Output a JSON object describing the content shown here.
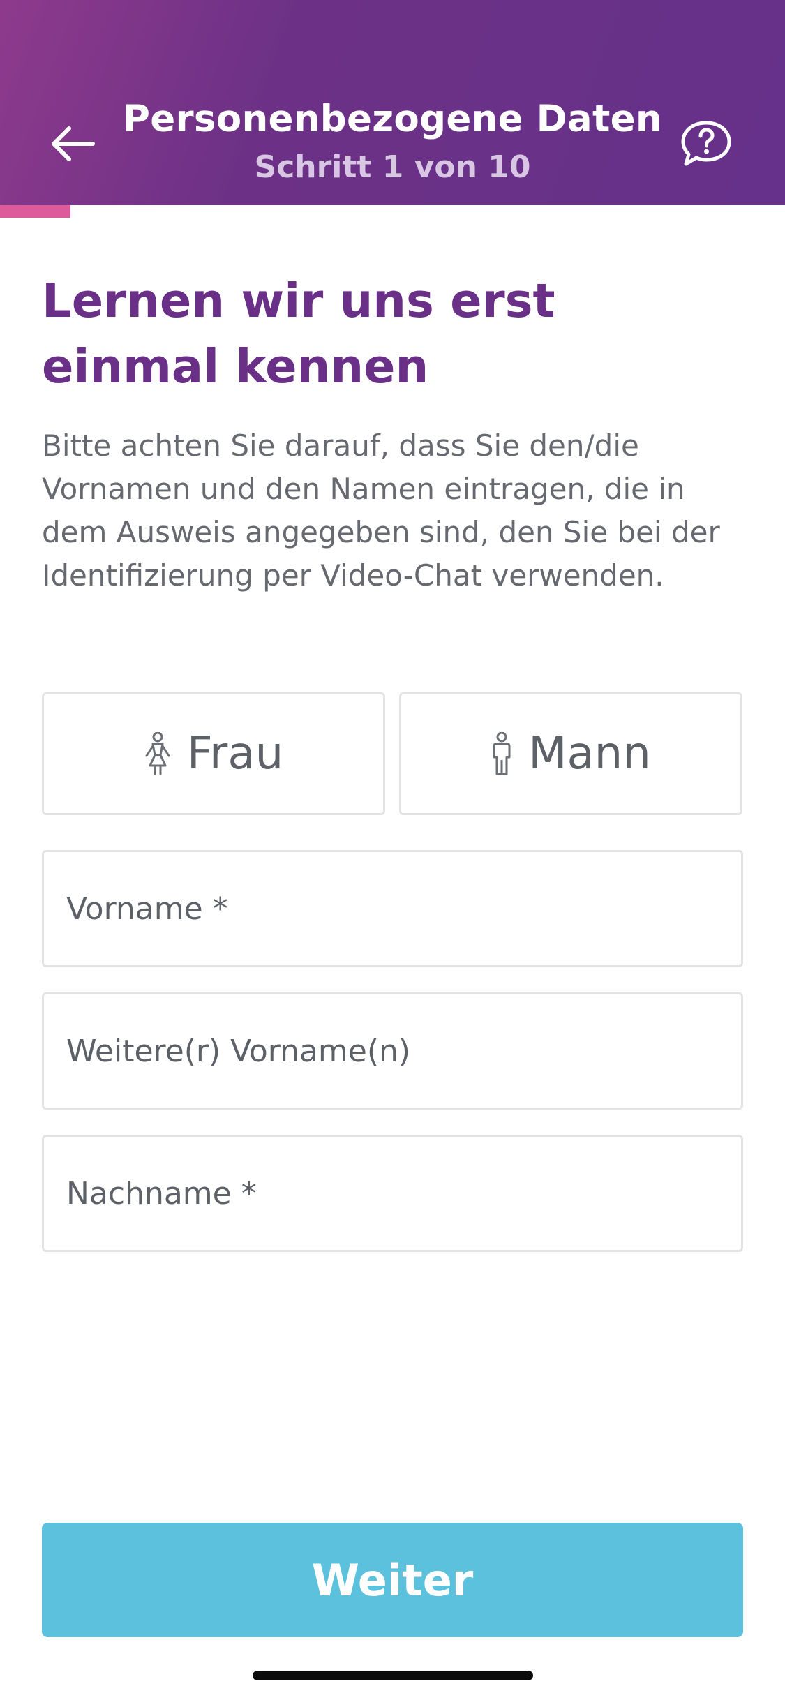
{
  "header": {
    "title": "Personenbezogene Daten",
    "step_text": "Schritt 1 von 10",
    "back_icon": "arrow-left-icon",
    "help_icon": "help-chat-bubble-icon",
    "step_current": 1,
    "step_total": 10
  },
  "progress": {
    "fraction": 0.1,
    "color": "#de5b9b"
  },
  "content": {
    "headline": "Lernen wir uns erst einmal kennen",
    "intro": "Bitte achten Sie darauf, dass Sie den/die Vornamen und den Namen eintragen, die in dem Ausweis angegeben sind, den Sie bei der Identifizierung per Video-Chat verwenden."
  },
  "gender": {
    "female_label": "Frau",
    "male_label": "Mann",
    "female_icon": "woman-figure-icon",
    "male_icon": "man-figure-icon"
  },
  "form": {
    "first_name_placeholder": "Vorname *",
    "first_name_value": "",
    "middle_names_placeholder": "Weitere(r) Vorname(n)",
    "middle_names_value": "",
    "last_name_placeholder": "Nachname *",
    "last_name_value": ""
  },
  "submit_label": "Weiter",
  "colors": {
    "header_gradient_start": "#8e3a8c",
    "header_gradient_end": "#66318a",
    "headline": "#6a2f86",
    "button": "#5bc1dc",
    "progress": "#de5b9b"
  }
}
